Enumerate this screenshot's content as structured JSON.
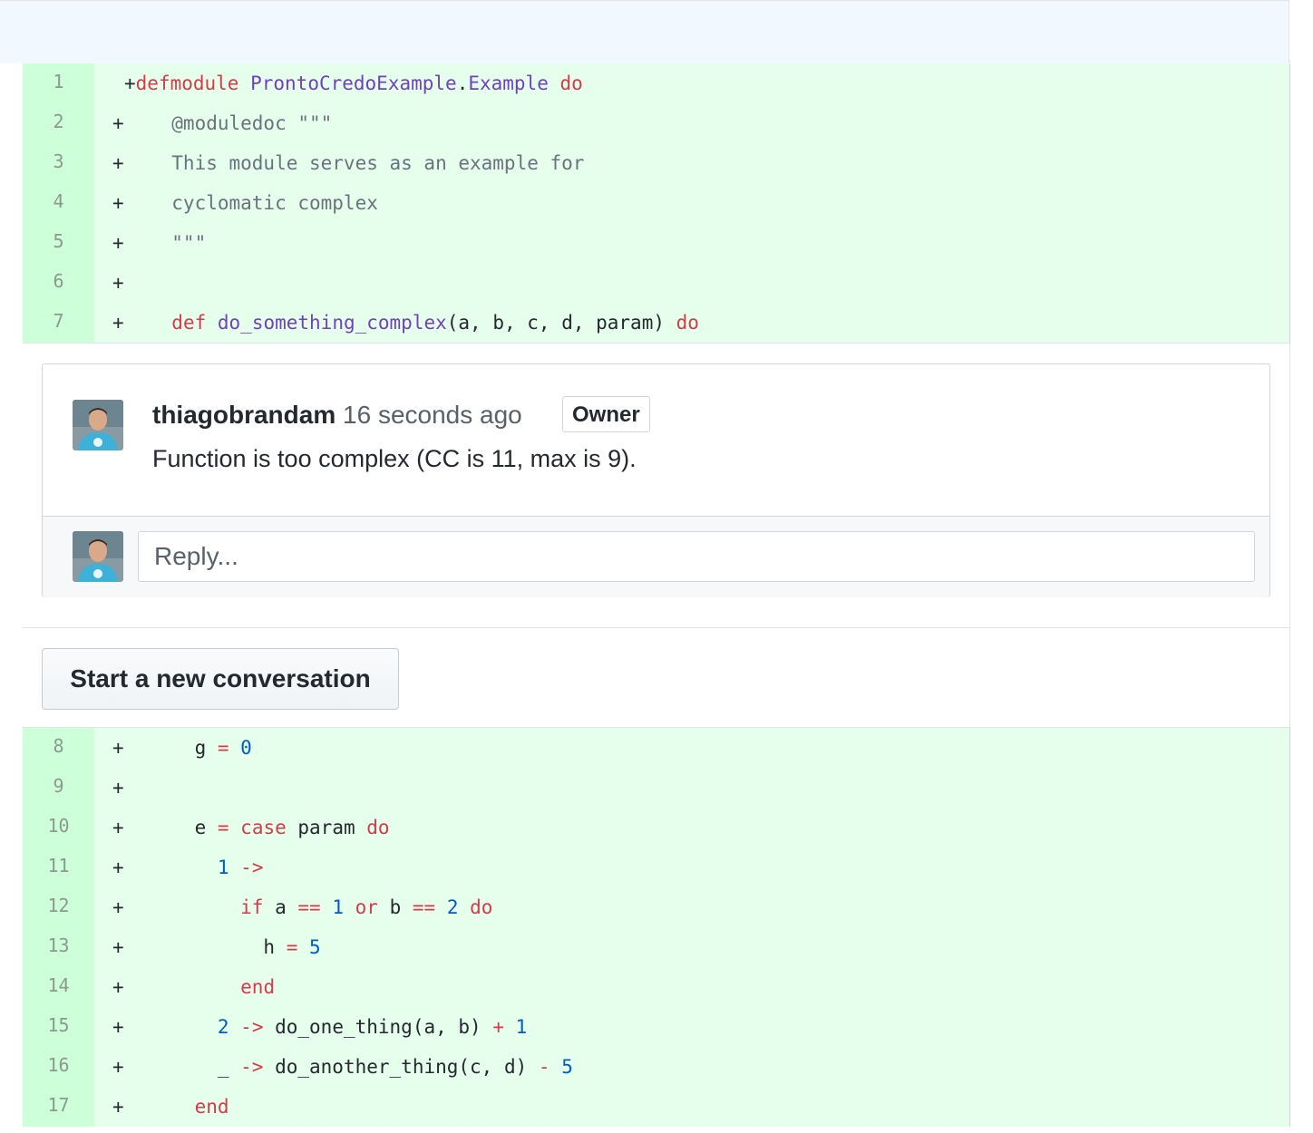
{
  "diff_top": [
    {
      "num": "1",
      "plus": "+",
      "tokens": [
        {
          "t": "defmodule",
          "c": "k"
        },
        {
          "t": " ",
          "c": "p"
        },
        {
          "t": "ProntoCredoExample",
          "c": "e"
        },
        {
          "t": ".",
          "c": "p"
        },
        {
          "t": "Example",
          "c": "e"
        },
        {
          "t": " ",
          "c": "p"
        },
        {
          "t": "do",
          "c": "k"
        }
      ]
    },
    {
      "num": "2",
      "plus": "+",
      "tokens": [
        {
          "t": "  @moduledoc \"\"\"",
          "c": "c"
        }
      ]
    },
    {
      "num": "3",
      "plus": "+",
      "tokens": [
        {
          "t": "  This module serves as an example for",
          "c": "c"
        }
      ]
    },
    {
      "num": "4",
      "plus": "+",
      "tokens": [
        {
          "t": "  cyclomatic complex",
          "c": "c"
        }
      ]
    },
    {
      "num": "5",
      "plus": "+",
      "tokens": [
        {
          "t": "  \"\"\"",
          "c": "c"
        }
      ]
    },
    {
      "num": "6",
      "plus": "+",
      "tokens": []
    },
    {
      "num": "7",
      "plus": "+",
      "tokens": [
        {
          "t": "  ",
          "c": "p"
        },
        {
          "t": "def",
          "c": "k"
        },
        {
          "t": " ",
          "c": "p"
        },
        {
          "t": "do_something_complex",
          "c": "e"
        },
        {
          "t": "(a, b, c, d, param) ",
          "c": "p"
        },
        {
          "t": "do",
          "c": "k"
        }
      ]
    }
  ],
  "comment": {
    "author": "thiagobrandam",
    "time": "16 seconds ago",
    "badge": "Owner",
    "body": "Function is too complex (CC is 11, max is 9).",
    "reply_placeholder": "Reply..."
  },
  "new_conversation_label": "Start a new conversation",
  "diff_bottom": [
    {
      "num": "8",
      "plus": "+",
      "tokens": [
        {
          "t": "    g ",
          "c": "p"
        },
        {
          "t": "=",
          "c": "k"
        },
        {
          "t": " ",
          "c": "p"
        },
        {
          "t": "0",
          "c": "n"
        }
      ]
    },
    {
      "num": "9",
      "plus": "+",
      "tokens": []
    },
    {
      "num": "10",
      "plus": "+",
      "tokens": [
        {
          "t": "    e ",
          "c": "p"
        },
        {
          "t": "=",
          "c": "k"
        },
        {
          "t": " ",
          "c": "p"
        },
        {
          "t": "case",
          "c": "k"
        },
        {
          "t": " param ",
          "c": "p"
        },
        {
          "t": "do",
          "c": "k"
        }
      ]
    },
    {
      "num": "11",
      "plus": "+",
      "tokens": [
        {
          "t": "      ",
          "c": "p"
        },
        {
          "t": "1",
          "c": "n"
        },
        {
          "t": " ",
          "c": "p"
        },
        {
          "t": "->",
          "c": "k"
        }
      ]
    },
    {
      "num": "12",
      "plus": "+",
      "tokens": [
        {
          "t": "        ",
          "c": "p"
        },
        {
          "t": "if",
          "c": "k"
        },
        {
          "t": " a ",
          "c": "p"
        },
        {
          "t": "==",
          "c": "k"
        },
        {
          "t": " ",
          "c": "p"
        },
        {
          "t": "1",
          "c": "n"
        },
        {
          "t": " ",
          "c": "p"
        },
        {
          "t": "or",
          "c": "k"
        },
        {
          "t": " b ",
          "c": "p"
        },
        {
          "t": "==",
          "c": "k"
        },
        {
          "t": " ",
          "c": "p"
        },
        {
          "t": "2",
          "c": "n"
        },
        {
          "t": " ",
          "c": "p"
        },
        {
          "t": "do",
          "c": "k"
        }
      ]
    },
    {
      "num": "13",
      "plus": "+",
      "tokens": [
        {
          "t": "          h ",
          "c": "p"
        },
        {
          "t": "=",
          "c": "k"
        },
        {
          "t": " ",
          "c": "p"
        },
        {
          "t": "5",
          "c": "n"
        }
      ]
    },
    {
      "num": "14",
      "plus": "+",
      "tokens": [
        {
          "t": "        ",
          "c": "p"
        },
        {
          "t": "end",
          "c": "k"
        }
      ]
    },
    {
      "num": "15",
      "plus": "+",
      "tokens": [
        {
          "t": "      ",
          "c": "p"
        },
        {
          "t": "2",
          "c": "n"
        },
        {
          "t": " ",
          "c": "p"
        },
        {
          "t": "->",
          "c": "k"
        },
        {
          "t": " do_one_thing(a, b) ",
          "c": "p"
        },
        {
          "t": "+",
          "c": "k"
        },
        {
          "t": " ",
          "c": "p"
        },
        {
          "t": "1",
          "c": "n"
        }
      ]
    },
    {
      "num": "16",
      "plus": "+",
      "tokens": [
        {
          "t": "      _ ",
          "c": "p"
        },
        {
          "t": "->",
          "c": "k"
        },
        {
          "t": " do_another_thing(c, d) ",
          "c": "p"
        },
        {
          "t": "-",
          "c": "k"
        },
        {
          "t": " ",
          "c": "p"
        },
        {
          "t": "5",
          "c": "n"
        }
      ]
    },
    {
      "num": "17",
      "plus": "+",
      "tokens": [
        {
          "t": "    ",
          "c": "p"
        },
        {
          "t": "end",
          "c": "k"
        }
      ]
    }
  ]
}
